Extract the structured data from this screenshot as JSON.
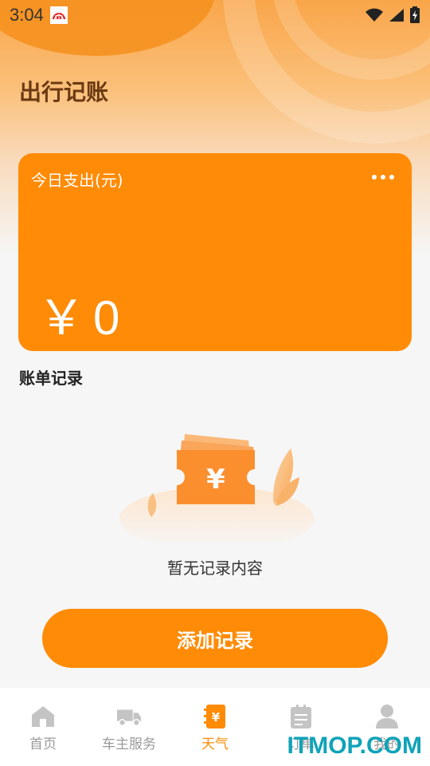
{
  "status_bar": {
    "time": "3:04"
  },
  "header": {
    "title": "出行记账"
  },
  "expense_card": {
    "label": "今日支出(元)",
    "currency": "￥",
    "amount": "0"
  },
  "records": {
    "section_title": "账单记录",
    "empty_text": "暂无记录内容"
  },
  "add_button": {
    "label": "添加记录"
  },
  "tabbar": {
    "items": [
      {
        "label": "首页",
        "icon": "home-icon",
        "active": false
      },
      {
        "label": "车主服务",
        "icon": "truck-icon",
        "active": false
      },
      {
        "label": "天气",
        "icon": "ledger-icon",
        "active": true
      },
      {
        "label": "订单",
        "icon": "clipboard-icon",
        "active": false
      },
      {
        "label": "我的",
        "icon": "user-icon",
        "active": false
      }
    ]
  },
  "watermark": {
    "text": "ITMOP.COM"
  },
  "colors": {
    "accent": "#ff8b06",
    "title": "#6b3a12",
    "tab_inactive": "#9a9a9a",
    "watermark": "#0fa3b8"
  }
}
